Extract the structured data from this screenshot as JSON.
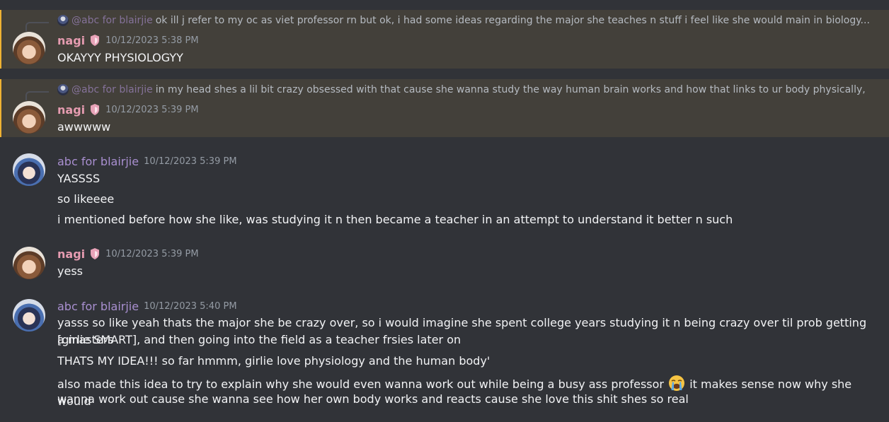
{
  "messages": [
    {
      "author": "nagi",
      "timestamp": "10/12/2023 5:38 PM",
      "reply": {
        "author": "@abc for blairjie",
        "text": "ok ill j refer to my oc as viet professor rn but ok, i had some ideas regarding the major she teaches n stuff i feel like she would main in biology... or like a m"
      },
      "lines": [
        "OKAYYY PHYSIOLOGYY"
      ]
    },
    {
      "author": "nagi",
      "timestamp": "10/12/2023 5:39 PM",
      "reply": {
        "author": "@abc for blairjie",
        "text": "in my head shes a lil bit crazy obsessed with that cause she wanna study the way human brain works and how that links to ur body physically, her actual"
      },
      "lines": [
        "awwwww"
      ]
    },
    {
      "author": "abc for blairjie",
      "timestamp": "10/12/2023 5:39 PM",
      "lines": [
        "YASSSS",
        "so likeeee",
        "i mentioned before how she like, was studying it n then became a teacher in an attempt to understand it better n such"
      ]
    },
    {
      "author": "nagi",
      "timestamp": "10/12/2023 5:39 PM",
      "lines": [
        "yess"
      ]
    },
    {
      "author": "abc for blairjie",
      "timestamp": "10/12/2023 5:40 PM",
      "lines": [
        "yasss so like yeah thats the major she be crazy over, so i would imagine she spent college years studying it n being crazy over til prob getting a masters",
        "[girlie SMART], and then going into the field as a teacher frsies later on",
        "THATS MY IDEA!!! so far hmmm, girlie love physiology and the human body'",
        "also made this idea to try to explain why she would even wanna work out while being a busy ass professor",
        "it makes sense now why she would",
        "wanna work out cause she wanna see how her own body works and reacts cause she love this shit shes so real"
      ]
    }
  ],
  "icons": {
    "role": "shield-heart-icon",
    "emoji": "loudly-crying-face-emoji"
  },
  "colors": {
    "background": "#313338",
    "mention_highlight": "#43403a",
    "mention_bar": "#f0b232",
    "nagi_name": "#e59bb0",
    "abc_name": "#a98fd0"
  }
}
